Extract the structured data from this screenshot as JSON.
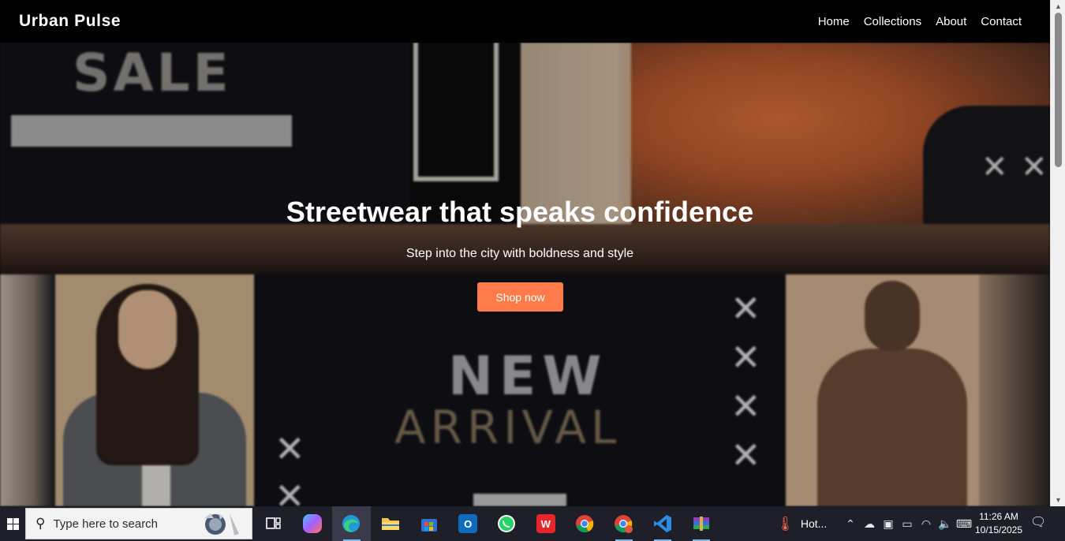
{
  "navbar": {
    "brand": "Urban Pulse",
    "links": [
      "Home",
      "Collections",
      "About",
      "Contact"
    ]
  },
  "hero": {
    "title": "Streetwear that speaks confidence",
    "subtitle": "Step into the city with boldness and style",
    "cta_label": "Shop now",
    "cta_color": "#ff7b4a",
    "background_texts": {
      "sale": "SALE",
      "new": "NEW",
      "arrival": "ARRIVAL"
    }
  },
  "taskbar": {
    "search_placeholder": "Type here to search",
    "apps": [
      {
        "name": "task-view",
        "icon": "task-view-icon"
      },
      {
        "name": "copilot",
        "icon": "copilot-icon"
      },
      {
        "name": "edge",
        "icon": "edge-icon",
        "active": true
      },
      {
        "name": "file-explorer",
        "icon": "folder-icon"
      },
      {
        "name": "microsoft-store",
        "icon": "store-icon"
      },
      {
        "name": "outlook",
        "icon": "outlook-icon"
      },
      {
        "name": "whatsapp",
        "icon": "whatsapp-icon"
      },
      {
        "name": "wps-office",
        "icon": "wps-icon"
      },
      {
        "name": "chrome",
        "icon": "chrome-icon"
      },
      {
        "name": "chrome-profile",
        "icon": "chrome-profile-icon"
      },
      {
        "name": "vscode",
        "icon": "vscode-icon"
      },
      {
        "name": "winrar",
        "icon": "winrar-icon"
      }
    ],
    "weather_label": "Hot...",
    "time": "11:26 AM",
    "date": "10/15/2025"
  }
}
